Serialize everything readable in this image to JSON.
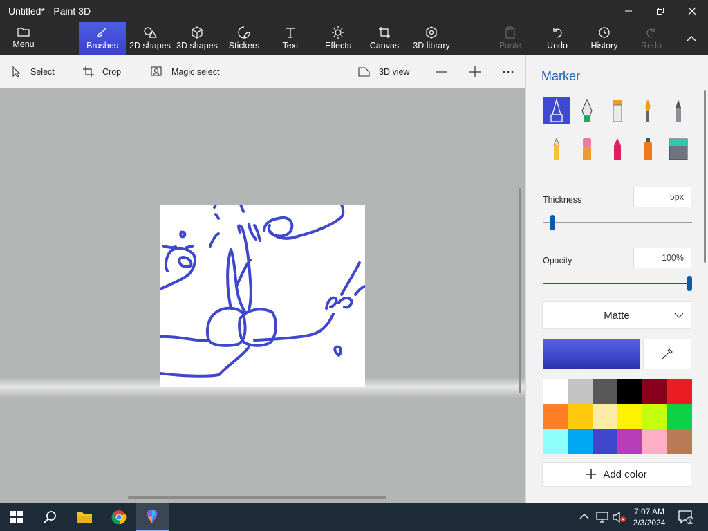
{
  "window": {
    "title": "Untitled* - Paint 3D"
  },
  "ribbon": {
    "menu": "Menu",
    "tabs": [
      {
        "label": "Brushes",
        "icon": "brush-icon",
        "active": true
      },
      {
        "label": "2D shapes",
        "icon": "2d-shapes-icon"
      },
      {
        "label": "3D shapes",
        "icon": "3d-shapes-icon"
      },
      {
        "label": "Stickers",
        "icon": "sticker-icon"
      },
      {
        "label": "Text",
        "icon": "text-icon"
      },
      {
        "label": "Effects",
        "icon": "effects-icon"
      },
      {
        "label": "Canvas",
        "icon": "canvas-icon"
      },
      {
        "label": "3D library",
        "icon": "3d-library-icon"
      }
    ],
    "actions": {
      "paste": "Paste",
      "undo": "Undo",
      "history": "History",
      "redo": "Redo"
    }
  },
  "toolbar": {
    "select": "Select",
    "crop": "Crop",
    "magic_select": "Magic select",
    "view3d": "3D view"
  },
  "panel": {
    "title": "Marker",
    "brushes": [
      "marker",
      "calligraphy-pen",
      "oil-brush",
      "watercolor",
      "pixel-pen",
      "pencil",
      "eraser",
      "crayon",
      "spray-can",
      "fill"
    ],
    "thickness_label": "Thickness",
    "thickness_value": "5px",
    "thickness_fraction": 0.05,
    "opacity_label": "Opacity",
    "opacity_value": "100%",
    "opacity_fraction": 1.0,
    "finish": "Matte",
    "current_color": "#3f48cc",
    "palette": [
      "#ffffff",
      "#c3c3c3",
      "#585858",
      "#000000",
      "#88001b",
      "#ec1c24",
      "#ff7f27",
      "#ffc90e",
      "#fdeca6",
      "#fff200",
      "#c4ff0e",
      "#0ed145",
      "#8cfffb",
      "#00a8f3",
      "#3f48cc",
      "#b83dba",
      "#ffaec8",
      "#b97a56"
    ],
    "add_color": "Add color"
  },
  "taskbar": {
    "time": "7:07 AM",
    "date": "2/3/2024",
    "notifications": "1"
  }
}
